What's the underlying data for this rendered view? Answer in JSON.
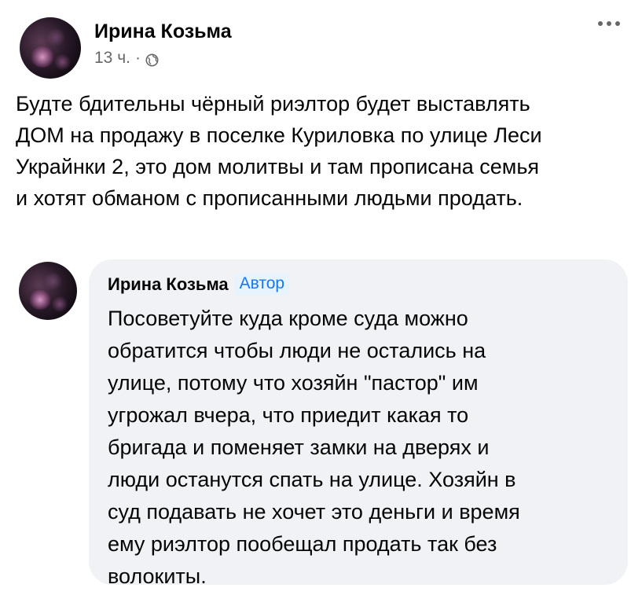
{
  "post": {
    "author": "Ирина Козьма",
    "time": "13 ч.",
    "separator": "·",
    "privacy_icon": "globe-icon",
    "menu_icon": "more-horizontal-icon",
    "text_lines": [
      "Будте бдительны чёрный риэлтор будет выставлять",
      "ДОМ на продажу в поселке Куриловка по улице Леси",
      "Украйнки 2, это дом молитвы и там прописана семья",
      "и хотят обманом с прописанными людьми продать."
    ]
  },
  "comment": {
    "author": "Ирина Козьма",
    "badge": "Автор",
    "text_lines": [
      "Посоветуйте куда кроме суда можно",
      "обратится чтобы люди не остались на",
      "улице, потому что хозяйн \"пастор\" им",
      "угрожал вчера, что приедит какая то",
      "бригада и поменяет замки на дверях и",
      "люди останутся спать на улице. Хозяйн в",
      "суд подавать не хочет это деньги и время",
      "ему риэлтор пообещал продать так без",
      "волокиты."
    ]
  },
  "colors": {
    "text_primary": "#050505",
    "text_secondary": "#65676b",
    "bubble_bg": "#f0f2f5",
    "badge_text": "#1877f2",
    "badge_bg": "#e7f3ff"
  }
}
